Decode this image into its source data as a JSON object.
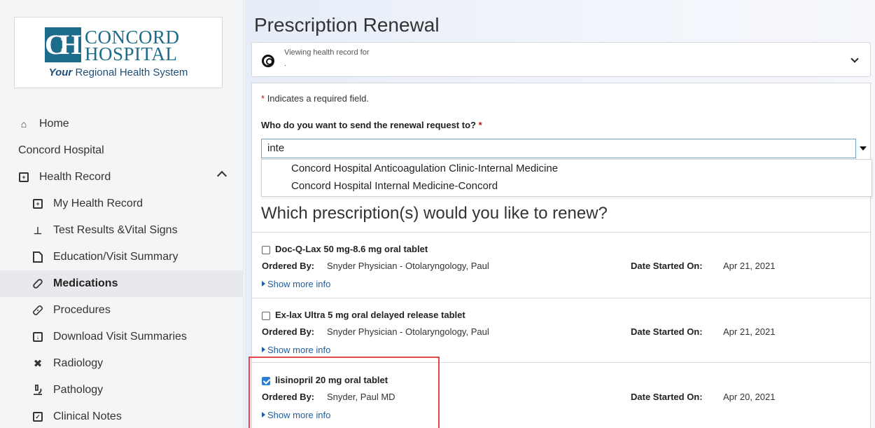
{
  "logo": {
    "line1": "CONCORD",
    "line2": "HOSPITAL",
    "tag_em": "Your",
    "tag_rest": "Regional Health System",
    "brand_color": "#1d6c8c"
  },
  "nav": {
    "home": "Home",
    "org": "Concord Hospital",
    "health_record": "Health Record",
    "items": [
      {
        "label": "My Health Record",
        "icon": "record-icon"
      },
      {
        "label": "Test Results &Vital Signs",
        "icon": "flask-icon"
      },
      {
        "label": "Education/Visit Summary",
        "icon": "document-icon"
      },
      {
        "label": "Medications",
        "icon": "pill-icon"
      },
      {
        "label": "Procedures",
        "icon": "bandage-icon"
      },
      {
        "label": "Download Visit Summaries",
        "icon": "download-icon"
      },
      {
        "label": "Radiology",
        "icon": "radiology-icon"
      },
      {
        "label": "Pathology",
        "icon": "microscope-icon"
      },
      {
        "label": "Clinical Notes",
        "icon": "notes-icon"
      }
    ]
  },
  "page": {
    "title": "Prescription Renewal",
    "viewing_label": "Viewing health record for",
    "viewing_name": ".",
    "required_note": "Indicates a required field.",
    "required_mark": "*",
    "who_label": "Who do you want to send the renewal request to?",
    "who_value": "inte",
    "options": [
      "Concord Hospital Anticoagulation Clinic-Internal Medicine",
      "Concord Hospital Internal Medicine-Concord"
    ],
    "which_title": "Which prescription(s) would you like to renew?"
  },
  "labels": {
    "ordered_by": "Ordered By:",
    "date_started": "Date Started On:",
    "show_more": "Show more info"
  },
  "medications": [
    {
      "name": "Doc-Q-Lax 50 mg-8.6 mg oral tablet",
      "ordered_by": "Snyder Physician - Otolaryngology, Paul",
      "date": "Apr 21, 2021",
      "checked": false
    },
    {
      "name": "Ex-lax Ultra 5 mg oral delayed release tablet",
      "ordered_by": "Snyder Physician - Otolaryngology, Paul",
      "date": "Apr 21, 2021",
      "checked": false
    },
    {
      "name": "lisinopril 20 mg oral tablet",
      "ordered_by": "Snyder, Paul MD",
      "date": "Apr 20, 2021",
      "checked": true
    }
  ],
  "colors": {
    "accent": "#2a7fd4",
    "link": "#1f5e9c",
    "required": "#c0121b",
    "highlight": "#e0484a"
  }
}
